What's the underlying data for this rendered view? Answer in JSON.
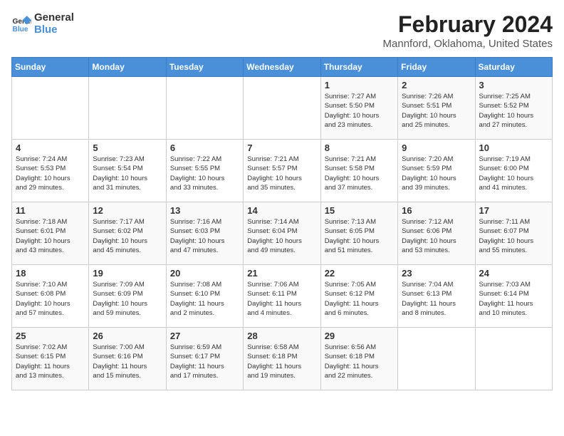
{
  "logo": {
    "line1": "General",
    "line2": "Blue"
  },
  "title": "February 2024",
  "subtitle": "Mannford, Oklahoma, United States",
  "days_of_week": [
    "Sunday",
    "Monday",
    "Tuesday",
    "Wednesday",
    "Thursday",
    "Friday",
    "Saturday"
  ],
  "weeks": [
    [
      {
        "day": "",
        "info": ""
      },
      {
        "day": "",
        "info": ""
      },
      {
        "day": "",
        "info": ""
      },
      {
        "day": "",
        "info": ""
      },
      {
        "day": "1",
        "info": "Sunrise: 7:27 AM\nSunset: 5:50 PM\nDaylight: 10 hours\nand 23 minutes."
      },
      {
        "day": "2",
        "info": "Sunrise: 7:26 AM\nSunset: 5:51 PM\nDaylight: 10 hours\nand 25 minutes."
      },
      {
        "day": "3",
        "info": "Sunrise: 7:25 AM\nSunset: 5:52 PM\nDaylight: 10 hours\nand 27 minutes."
      }
    ],
    [
      {
        "day": "4",
        "info": "Sunrise: 7:24 AM\nSunset: 5:53 PM\nDaylight: 10 hours\nand 29 minutes."
      },
      {
        "day": "5",
        "info": "Sunrise: 7:23 AM\nSunset: 5:54 PM\nDaylight: 10 hours\nand 31 minutes."
      },
      {
        "day": "6",
        "info": "Sunrise: 7:22 AM\nSunset: 5:55 PM\nDaylight: 10 hours\nand 33 minutes."
      },
      {
        "day": "7",
        "info": "Sunrise: 7:21 AM\nSunset: 5:57 PM\nDaylight: 10 hours\nand 35 minutes."
      },
      {
        "day": "8",
        "info": "Sunrise: 7:21 AM\nSunset: 5:58 PM\nDaylight: 10 hours\nand 37 minutes."
      },
      {
        "day": "9",
        "info": "Sunrise: 7:20 AM\nSunset: 5:59 PM\nDaylight: 10 hours\nand 39 minutes."
      },
      {
        "day": "10",
        "info": "Sunrise: 7:19 AM\nSunset: 6:00 PM\nDaylight: 10 hours\nand 41 minutes."
      }
    ],
    [
      {
        "day": "11",
        "info": "Sunrise: 7:18 AM\nSunset: 6:01 PM\nDaylight: 10 hours\nand 43 minutes."
      },
      {
        "day": "12",
        "info": "Sunrise: 7:17 AM\nSunset: 6:02 PM\nDaylight: 10 hours\nand 45 minutes."
      },
      {
        "day": "13",
        "info": "Sunrise: 7:16 AM\nSunset: 6:03 PM\nDaylight: 10 hours\nand 47 minutes."
      },
      {
        "day": "14",
        "info": "Sunrise: 7:14 AM\nSunset: 6:04 PM\nDaylight: 10 hours\nand 49 minutes."
      },
      {
        "day": "15",
        "info": "Sunrise: 7:13 AM\nSunset: 6:05 PM\nDaylight: 10 hours\nand 51 minutes."
      },
      {
        "day": "16",
        "info": "Sunrise: 7:12 AM\nSunset: 6:06 PM\nDaylight: 10 hours\nand 53 minutes."
      },
      {
        "day": "17",
        "info": "Sunrise: 7:11 AM\nSunset: 6:07 PM\nDaylight: 10 hours\nand 55 minutes."
      }
    ],
    [
      {
        "day": "18",
        "info": "Sunrise: 7:10 AM\nSunset: 6:08 PM\nDaylight: 10 hours\nand 57 minutes."
      },
      {
        "day": "19",
        "info": "Sunrise: 7:09 AM\nSunset: 6:09 PM\nDaylight: 10 hours\nand 59 minutes."
      },
      {
        "day": "20",
        "info": "Sunrise: 7:08 AM\nSunset: 6:10 PM\nDaylight: 11 hours\nand 2 minutes."
      },
      {
        "day": "21",
        "info": "Sunrise: 7:06 AM\nSunset: 6:11 PM\nDaylight: 11 hours\nand 4 minutes."
      },
      {
        "day": "22",
        "info": "Sunrise: 7:05 AM\nSunset: 6:12 PM\nDaylight: 11 hours\nand 6 minutes."
      },
      {
        "day": "23",
        "info": "Sunrise: 7:04 AM\nSunset: 6:13 PM\nDaylight: 11 hours\nand 8 minutes."
      },
      {
        "day": "24",
        "info": "Sunrise: 7:03 AM\nSunset: 6:14 PM\nDaylight: 11 hours\nand 10 minutes."
      }
    ],
    [
      {
        "day": "25",
        "info": "Sunrise: 7:02 AM\nSunset: 6:15 PM\nDaylight: 11 hours\nand 13 minutes."
      },
      {
        "day": "26",
        "info": "Sunrise: 7:00 AM\nSunset: 6:16 PM\nDaylight: 11 hours\nand 15 minutes."
      },
      {
        "day": "27",
        "info": "Sunrise: 6:59 AM\nSunset: 6:17 PM\nDaylight: 11 hours\nand 17 minutes."
      },
      {
        "day": "28",
        "info": "Sunrise: 6:58 AM\nSunset: 6:18 PM\nDaylight: 11 hours\nand 19 minutes."
      },
      {
        "day": "29",
        "info": "Sunrise: 6:56 AM\nSunset: 6:18 PM\nDaylight: 11 hours\nand 22 minutes."
      },
      {
        "day": "",
        "info": ""
      },
      {
        "day": "",
        "info": ""
      }
    ]
  ]
}
